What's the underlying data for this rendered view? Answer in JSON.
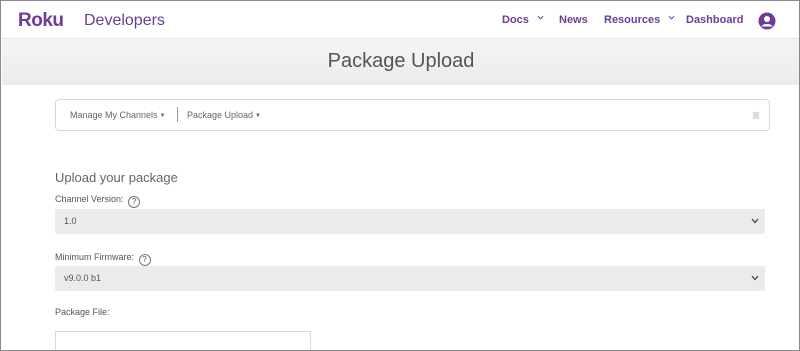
{
  "header": {
    "logo": "Roku",
    "logo_sub": "Developers",
    "nav": {
      "docs": "Docs",
      "news": "News",
      "resources": "Resources",
      "dashboard": "Dashboard"
    },
    "brand_color": "#6c3c97"
  },
  "page": {
    "title": "Package Upload"
  },
  "breadcrumb": {
    "item1": "Manage My Channels",
    "item2": "Package Upload"
  },
  "form": {
    "section_title": "Upload your package",
    "channel_version": {
      "label": "Channel Version:",
      "help": "?",
      "value": "1.0"
    },
    "minimum_firmware": {
      "label": "Minimum Firmware:",
      "help": "?",
      "value": "v9.0.0 b1"
    },
    "package_file": {
      "label": "Package File:"
    }
  }
}
